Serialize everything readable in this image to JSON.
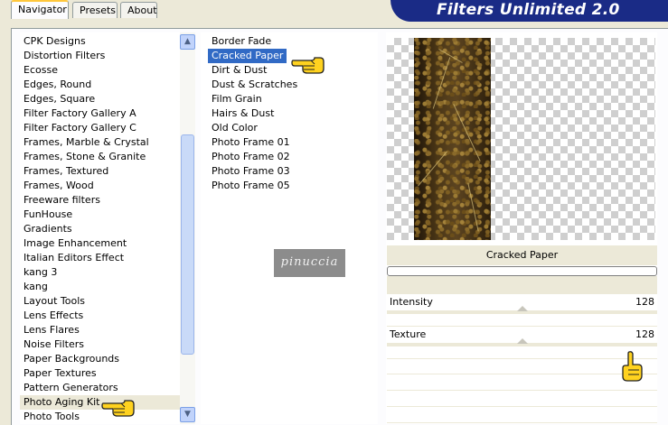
{
  "title": "Filters Unlimited 2.0",
  "tabs": [
    {
      "label": "Navigator",
      "active": true
    },
    {
      "label": "Presets",
      "active": false
    },
    {
      "label": "About",
      "active": false
    }
  ],
  "categories": [
    "CPK Designs",
    "Distortion Filters",
    "Ecosse",
    "Edges, Round",
    "Edges, Square",
    "Filter Factory Gallery A",
    "Filter Factory Gallery C",
    "Frames, Marble & Crystal",
    "Frames, Stone & Granite",
    "Frames, Textured",
    "Frames, Wood",
    "Freeware filters",
    "FunHouse",
    "Gradients",
    "Image Enhancement",
    "Italian Editors Effect",
    "kang 3",
    "kang",
    "Layout Tools",
    "Lens Effects",
    "Lens Flares",
    "Noise Filters",
    "Paper Backgrounds",
    "Paper Textures",
    "Pattern Generators",
    "Photo Aging Kit",
    "Photo Tools"
  ],
  "selected_category": "Photo Aging Kit",
  "filters": [
    "Border Fade",
    "Cracked Paper",
    "Dirt & Dust",
    "Dust & Scratches",
    "Film Grain",
    "Hairs & Dust",
    "Old Color",
    "Photo Frame 01",
    "Photo Frame 02",
    "Photo Frame 03",
    "Photo Frame 05"
  ],
  "selected_filter": "Cracked Paper",
  "signature": "pinuccia",
  "preview": {
    "filter_name": "Cracked Paper"
  },
  "sliders": [
    {
      "label": "Intensity",
      "value": "128"
    },
    {
      "label": "Texture",
      "value": "128"
    }
  ],
  "colors": {
    "banner": "#1a2b86",
    "selection": "#316ac5",
    "tab_accent": "#ffc73c"
  }
}
